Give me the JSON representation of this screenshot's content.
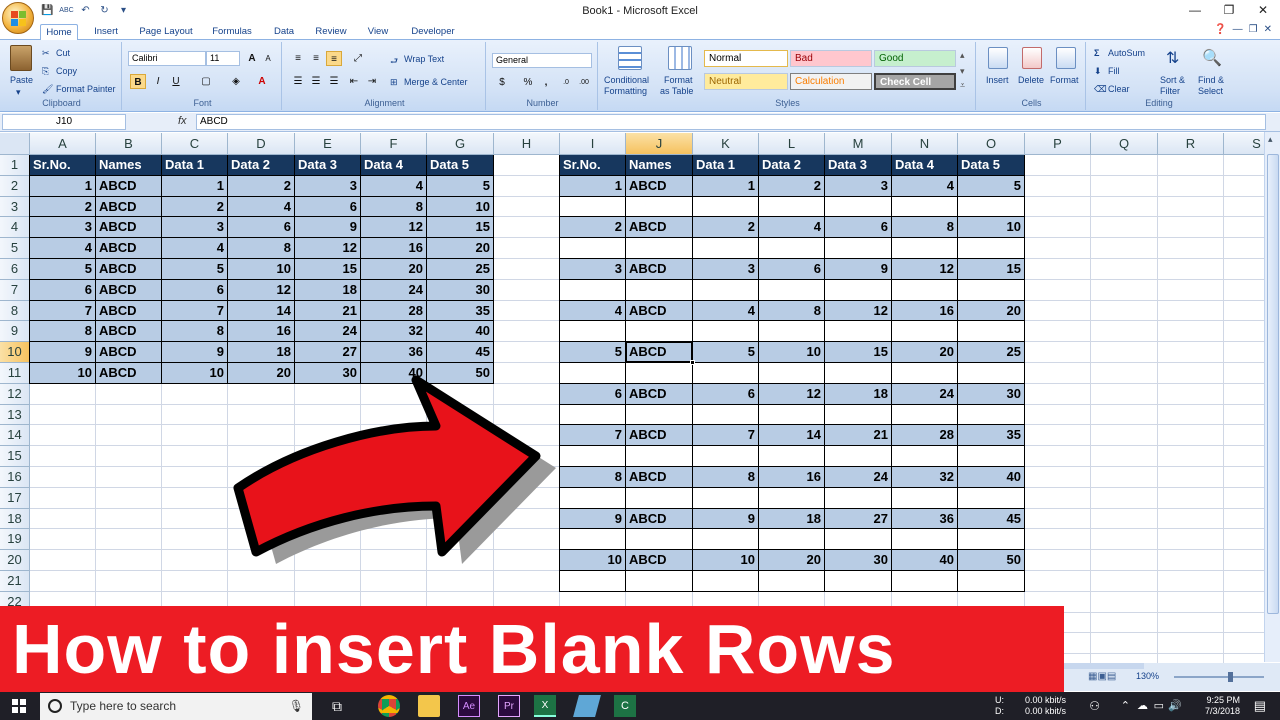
{
  "window": {
    "title": "Book1 - Microsoft Excel",
    "min": "—",
    "max": "❐",
    "close": "✕"
  },
  "tabs": [
    "Home",
    "Insert",
    "Page Layout",
    "Formulas",
    "Data",
    "Review",
    "View",
    "Developer"
  ],
  "ribbon": {
    "clipboard": {
      "paste": "Paste",
      "cut": "Cut",
      "copy": "Copy",
      "format_painter": "Format Painter",
      "label": "Clipboard"
    },
    "font": {
      "name": "Calibri",
      "size": "11",
      "bold": "B",
      "italic": "I",
      "underline": "U",
      "grow": "A",
      "shrink": "A",
      "label": "Font"
    },
    "alignment": {
      "wrap": "Wrap Text",
      "merge": "Merge & Center",
      "label": "Alignment"
    },
    "number": {
      "format": "General",
      "currency": "$",
      "percent": "%",
      "comma": ",",
      "label": "Number"
    },
    "styles": {
      "conditional": "Conditional",
      "formatting": "Formatting",
      "format": "Format",
      "as_table": "as Table",
      "normal": "Normal",
      "bad": "Bad",
      "good": "Good",
      "neutral": "Neutral",
      "calculation": "Calculation",
      "check_cell": "Check Cell",
      "label": "Styles"
    },
    "cells": {
      "insert": "Insert",
      "delete": "Delete",
      "format": "Format",
      "label": "Cells"
    },
    "editing": {
      "autosum": "AutoSum",
      "fill": "Fill",
      "clear": "Clear",
      "sort": "Sort &",
      "filter": "Filter",
      "find": "Find &",
      "select": "Select",
      "label": "Editing"
    }
  },
  "formula_bar": {
    "name_box": "J10",
    "fx": "fx",
    "content": "ABCD"
  },
  "columns": [
    "A",
    "B",
    "C",
    "D",
    "E",
    "F",
    "G",
    "H",
    "I",
    "J",
    "K",
    "L",
    "M",
    "N",
    "O",
    "P",
    "Q",
    "R",
    "S"
  ],
  "rows": [
    "1",
    "2",
    "3",
    "4",
    "5",
    "6",
    "7",
    "8",
    "9",
    "10",
    "11",
    "12",
    "13",
    "14",
    "15",
    "16",
    "17",
    "18",
    "19",
    "20",
    "21",
    "22"
  ],
  "table_headers": [
    "Sr.No.",
    "Names",
    "Data 1",
    "Data 2",
    "Data 3",
    "Data 4",
    "Data 5"
  ],
  "left_table": [
    [
      "1",
      "ABCD",
      "1",
      "2",
      "3",
      "4",
      "5"
    ],
    [
      "2",
      "ABCD",
      "2",
      "4",
      "6",
      "8",
      "10"
    ],
    [
      "3",
      "ABCD",
      "3",
      "6",
      "9",
      "12",
      "15"
    ],
    [
      "4",
      "ABCD",
      "4",
      "8",
      "12",
      "16",
      "20"
    ],
    [
      "5",
      "ABCD",
      "5",
      "10",
      "15",
      "20",
      "25"
    ],
    [
      "6",
      "ABCD",
      "6",
      "12",
      "18",
      "24",
      "30"
    ],
    [
      "7",
      "ABCD",
      "7",
      "14",
      "21",
      "28",
      "35"
    ],
    [
      "8",
      "ABCD",
      "8",
      "16",
      "24",
      "32",
      "40"
    ],
    [
      "9",
      "ABCD",
      "9",
      "18",
      "27",
      "36",
      "45"
    ],
    [
      "10",
      "ABCD",
      "10",
      "20",
      "30",
      "40",
      "50"
    ]
  ],
  "right_table": [
    [
      "1",
      "ABCD",
      "1",
      "2",
      "3",
      "4",
      "5"
    ],
    [
      "2",
      "ABCD",
      "2",
      "4",
      "6",
      "8",
      "10"
    ],
    [
      "3",
      "ABCD",
      "3",
      "6",
      "9",
      "12",
      "15"
    ],
    [
      "4",
      "ABCD",
      "4",
      "8",
      "12",
      "16",
      "20"
    ],
    [
      "5",
      "ABCD",
      "5",
      "10",
      "15",
      "20",
      "25"
    ],
    [
      "6",
      "ABCD",
      "6",
      "12",
      "18",
      "24",
      "30"
    ],
    [
      "7",
      "ABCD",
      "7",
      "14",
      "21",
      "28",
      "35"
    ],
    [
      "8",
      "ABCD",
      "8",
      "16",
      "24",
      "32",
      "40"
    ],
    [
      "9",
      "ABCD",
      "9",
      "18",
      "27",
      "36",
      "45"
    ],
    [
      "10",
      "ABCD",
      "10",
      "20",
      "30",
      "40",
      "50"
    ]
  ],
  "banner": "How to insert Blank Rows",
  "status": {
    "zoom": "130%"
  },
  "taskbar": {
    "search": "Type here to search",
    "net_u": "U:",
    "net_d": "D:",
    "up": "0.00 kbit/s",
    "down": "0.00 kbit/s",
    "time": "9:25 PM",
    "date": "7/3/2018"
  },
  "colors": {
    "header_fill": "#17375e",
    "row_fill": "#b8cce4",
    "banner": "#ed1c24",
    "arrow": "#e8121a"
  }
}
